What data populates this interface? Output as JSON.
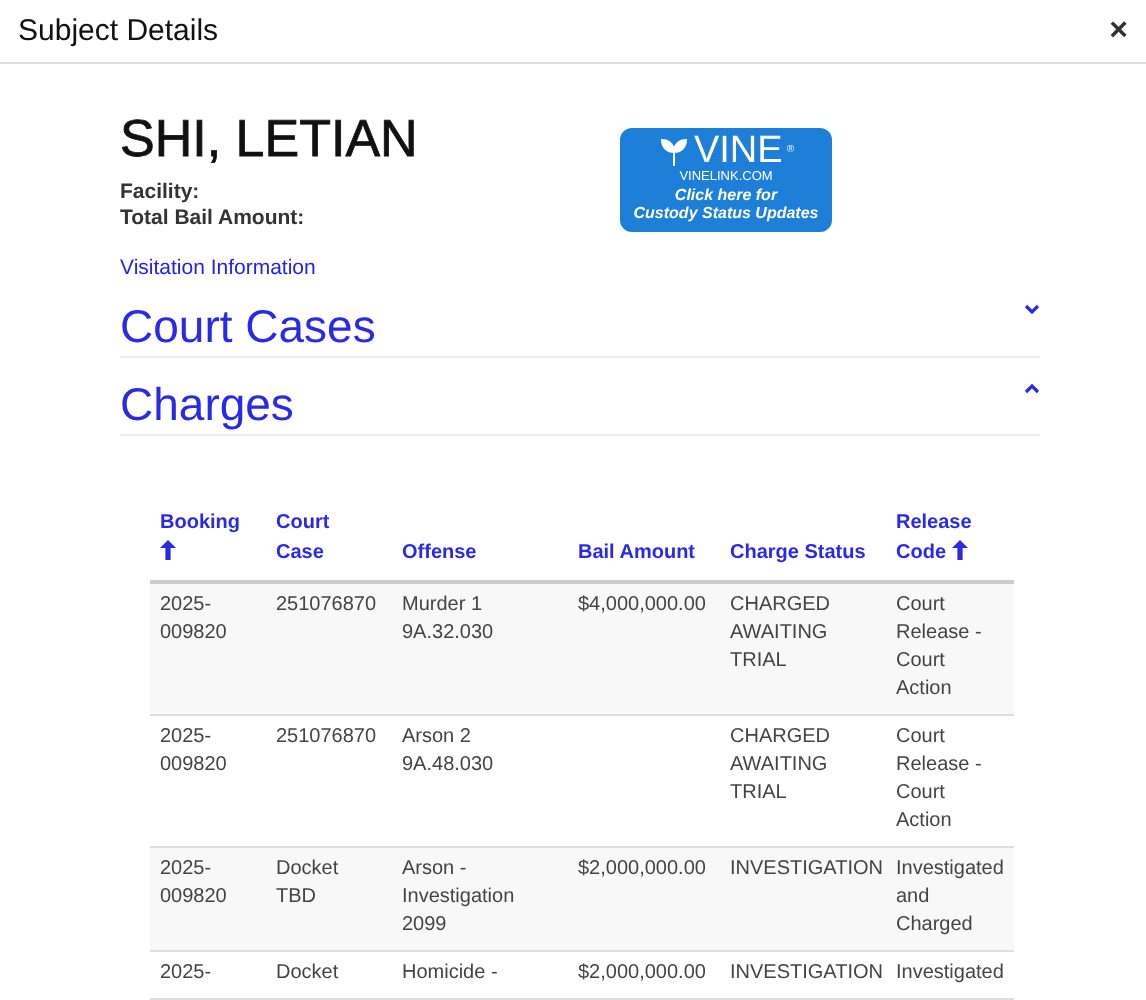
{
  "dialog": {
    "title": "Subject Details",
    "close": "×"
  },
  "subject": {
    "name": "SHI, LETIAN",
    "fields": [
      {
        "label": "Facility:"
      },
      {
        "label": "Total Bail Amount:"
      }
    ],
    "link": "Visitation Information"
  },
  "vine": {
    "brand": "VINE",
    "mark": "®",
    "site": "VINELINK.COM",
    "line1": "Click here for",
    "line2": "Custody Status Updates"
  },
  "sections": [
    {
      "title": "Court Cases",
      "expanded": false
    },
    {
      "title": "Charges",
      "expanded": true
    }
  ],
  "table": {
    "columns": [
      {
        "label": "Booking",
        "sorted": true
      },
      {
        "label": "Court Case",
        "sorted": false
      },
      {
        "label": "Offense",
        "sorted": false
      },
      {
        "label": "Bail Amount",
        "sorted": false
      },
      {
        "label": "Charge Status",
        "sorted": false
      },
      {
        "label": "Release Code",
        "sorted": true
      }
    ],
    "rows": [
      [
        "2025-009820",
        "251076870",
        "Murder 1 9A.32.030",
        "$4,000,000.00",
        "CHARGED AWAITING TRIAL",
        "Court Release - Court Action"
      ],
      [
        "2025-009820",
        "251076870",
        "Arson 2 9A.48.030",
        "",
        "CHARGED AWAITING TRIAL",
        "Court Release - Court Action"
      ],
      [
        "2025-009820",
        "Docket TBD",
        "Arson - Investigation 2099",
        "$2,000,000.00",
        "INVESTIGATION",
        "Investigated and Charged"
      ],
      [
        "2025-",
        "Docket",
        "Homicide -",
        "$2,000,000.00",
        "INVESTIGATION",
        "Investigated"
      ]
    ]
  }
}
